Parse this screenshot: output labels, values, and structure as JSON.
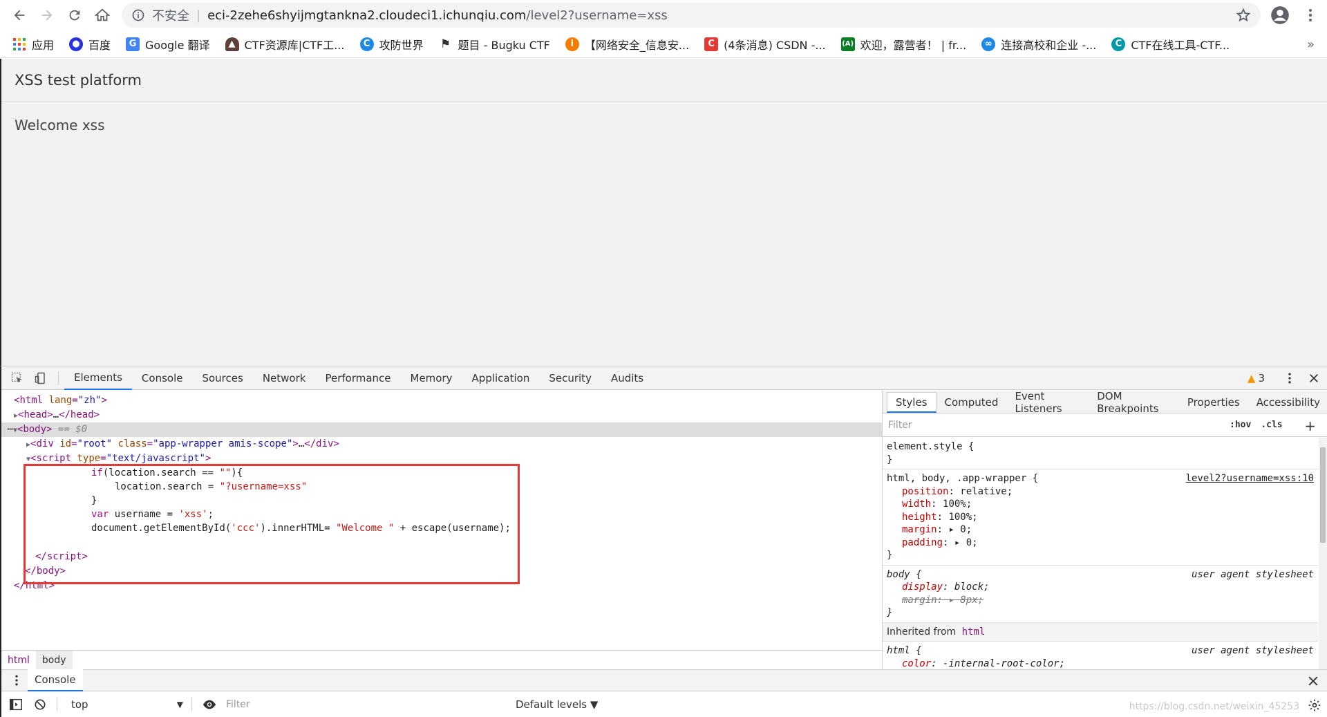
{
  "browser": {
    "url_insecure": "不安全",
    "url_separator": "|",
    "url_host": "eci-2zehe6shyijmgtankna2.cloudeci1.ichunqiu.com",
    "url_path": "/level2?username=xss"
  },
  "bookmarks": {
    "items": [
      {
        "label": "应用",
        "icon": "apps-icon",
        "color": "#ea4335"
      },
      {
        "label": "百度",
        "icon": "baidu-icon",
        "color": "#2932e1"
      },
      {
        "label": "Google 翻译",
        "icon": "google-translate-icon",
        "color": "#4285f4"
      },
      {
        "label": "CTF资源库|CTF工...",
        "icon": "ctf-resource-icon",
        "color": "#5d4037"
      },
      {
        "label": "攻防世界",
        "icon": "adworld-icon",
        "color": "#1e88e5"
      },
      {
        "label": "题目 - Bugku CTF",
        "icon": "bugku-flag-icon",
        "color": "#333333"
      },
      {
        "label": "【网络安全_信息安...",
        "icon": "security-icon",
        "color": "#f57c00"
      },
      {
        "label": "(4条消息) CSDN -...",
        "icon": "csdn-icon",
        "color": "#e53935"
      },
      {
        "label": "欢迎，露营者！ | fr...",
        "icon": "freecodecamp-icon",
        "color": "#0a7d29"
      },
      {
        "label": "连接高校和企业 -...",
        "icon": "nowcoder-icon",
        "color": "#1e88e5"
      },
      {
        "label": "CTF在线工具-CTF...",
        "icon": "ctf-tools-icon",
        "color": "#0097a7"
      }
    ],
    "more": "»"
  },
  "page": {
    "title": "XSS test platform",
    "welcome": "Welcome xss"
  },
  "devtools": {
    "tabs": [
      "Elements",
      "Console",
      "Sources",
      "Network",
      "Performance",
      "Memory",
      "Application",
      "Security",
      "Audits"
    ],
    "active_tab": "Elements",
    "warnings": "3",
    "dom": {
      "l1_tag": "html",
      "l1_attr": "lang",
      "l1_val": "\"zh\"",
      "l2": "head",
      "l2_ellipsis": "…",
      "l3_tag": "body",
      "l3_ref": "== $0",
      "l4_tag": "div",
      "l4_attr1": "id",
      "l4_val1": "\"root\"",
      "l4_attr2": "class",
      "l4_val2": "\"app-wrapper amis-scope\"",
      "l5_tag": "script",
      "l5_attr": "type",
      "l5_val": "\"text/javascript\"",
      "js1_kw": "if",
      "js1_rest": "(location.search == ",
      "js1_str": "\"\"",
      "js1_end": "){",
      "js2_rest": "location.search = ",
      "js2_str": "\"?username=xss\"",
      "js3": "}",
      "js4_kw": "var",
      "js4_rest": " username = ",
      "js4_str": "'xss'",
      "js4_end": ";",
      "js5_a": "document.getElementById(",
      "js5_str1": "'ccc'",
      "js5_b": ").innerHTML= ",
      "js5_str2": "\"Welcome \"",
      "js5_c": " + escape(username);",
      "close_script": "script",
      "close_body": "body",
      "close_html": "html"
    },
    "breadcrumbs": [
      "html",
      "body"
    ],
    "styles_tabs": [
      "Styles",
      "Computed",
      "Event Listeners",
      "DOM Breakpoints",
      "Properties",
      "Accessibility"
    ],
    "filter_placeholder": "Filter",
    "hov": ":hov",
    "cls": ".cls",
    "plus": "+",
    "rules": {
      "element_style": "element.style {",
      "close": "}",
      "r1_selector": "html, body, .app-wrapper {",
      "r1_source": "level2?username=xss:10",
      "r1_decls": [
        {
          "p": "position",
          "v": "relative;"
        },
        {
          "p": "width",
          "v": "100%;"
        },
        {
          "p": "height",
          "v": "100%;"
        },
        {
          "p": "margin",
          "v": "▸ 0;"
        },
        {
          "p": "padding",
          "v": "▸ 0;"
        }
      ],
      "r2_selector": "body {",
      "r2_source": "user agent stylesheet",
      "r2_d1_p": "display",
      "r2_d1_v": "block;",
      "r2_d2_p": "margin:",
      "r2_d2_v": "▸ 8px;",
      "inherited_label": "Inherited from",
      "inherited_tag": "html",
      "r3_selector": "html {",
      "r3_source": "user agent stylesheet",
      "r3_d1_p": "color",
      "r3_d1_v": "-internal-root-color;"
    },
    "drawer_tab": "Console",
    "console_context": "top",
    "console_filter_placeholder": "Filter",
    "console_levels": "Default levels ▼"
  },
  "watermark": "https://blog.csdn.net/weixin_45253",
  "colors": {
    "accent": "#1a73e8",
    "highlight_box": "#e53935",
    "warning": "#f29900"
  }
}
